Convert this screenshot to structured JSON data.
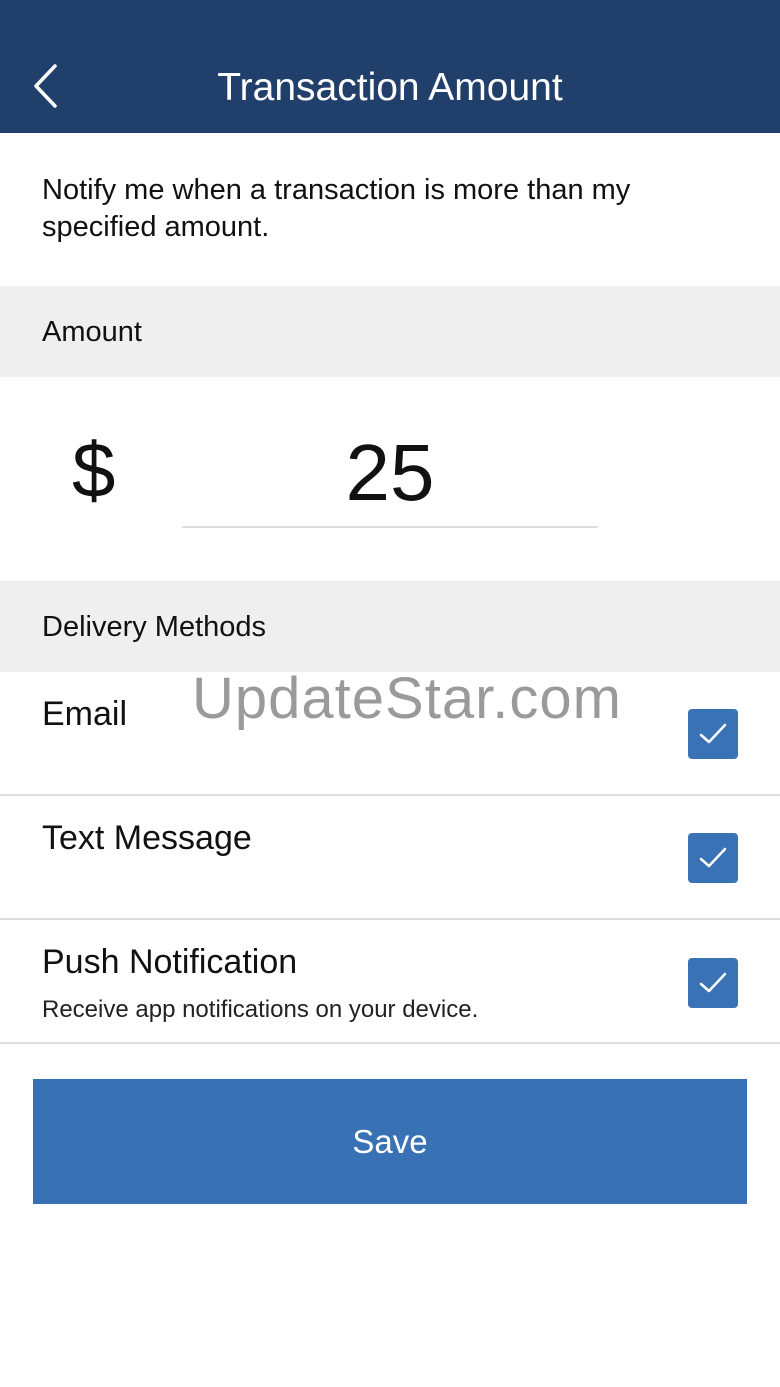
{
  "header": {
    "title": "Transaction Amount",
    "back_icon": "chevron-left-icon",
    "background": "#213f6b"
  },
  "intro": "Notify me when a transaction is more than my specified amount.",
  "amount_section": {
    "header": "Amount",
    "currency_symbol": "$",
    "value": "25"
  },
  "delivery_section": {
    "header": "Delivery Methods",
    "methods": [
      {
        "label": "Email",
        "checked": true
      },
      {
        "label": "Text Message",
        "checked": true
      },
      {
        "label": "Push Notification",
        "description": "Receive app notifications on your device.",
        "checked": true
      }
    ]
  },
  "watermark": "UpdateStar.com",
  "save_label": "Save",
  "colors": {
    "accent": "#3872b5",
    "checkbox": "#3a72b6",
    "section_bg": "#efefef"
  }
}
